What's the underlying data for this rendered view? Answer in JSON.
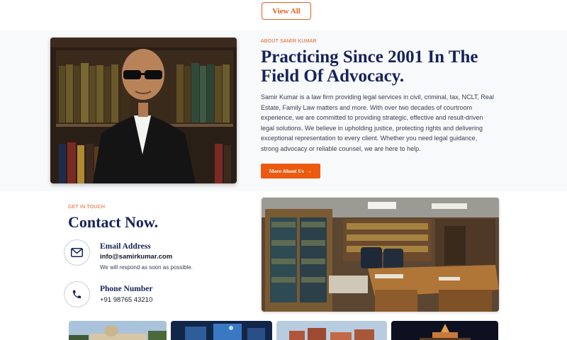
{
  "top": {
    "view_all_label": "View All"
  },
  "about": {
    "eyebrow": "ABOUT SAMIR KUMAR",
    "title_line1": "Practicing Since 2001 In The",
    "title_line2": "Field Of Advocacy.",
    "body": "Samir Kumar is a law firm providing legal services in civil, criminal, tax, NCLT, Real Estate, Family Law matters and more. With over two decades of courtroom experience, we are committed to providing strategic, effective and result-driven legal solutions. We believe in upholding justice, protecting rights and delivering exceptional representation to every client. Whether you need legal guidance, strong advocacy or reliable counsel, we are here to help.",
    "button_label": "More About Us",
    "button_arrow": "→"
  },
  "contact": {
    "eyebrow": "GET IN TOUCH",
    "title": "Contact Now.",
    "email": {
      "label": "Email Address",
      "value": "info@samirkumar.com",
      "note": "We will respond as soon as possible.",
      "icon": "envelope-icon"
    },
    "phone": {
      "label": "Phone Number",
      "value": "+91 98765 43210",
      "icon": "phone-icon"
    }
  },
  "colors": {
    "accent": "#e85d1c",
    "navy": "#16235a",
    "section_bg": "#f8f9fb"
  }
}
